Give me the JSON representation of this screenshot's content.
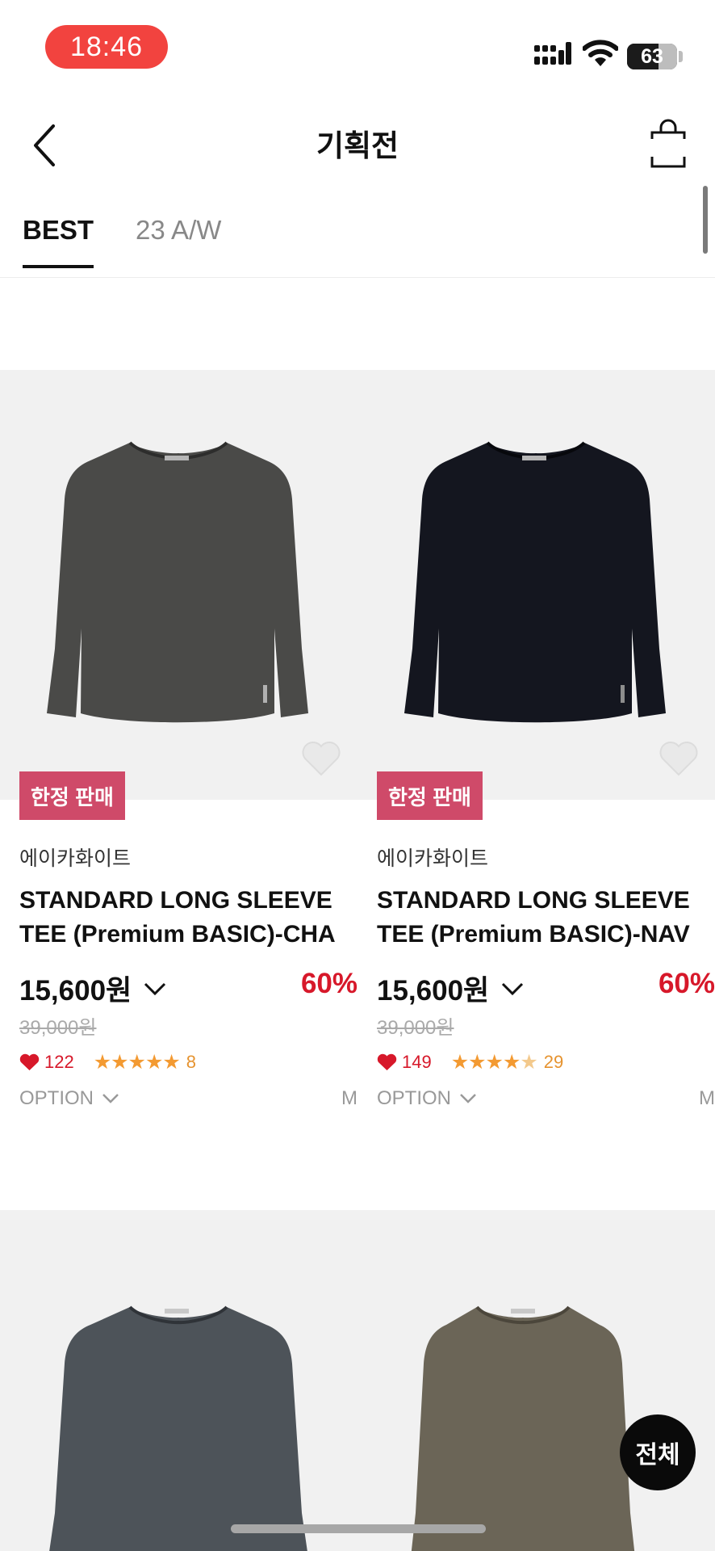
{
  "status_bar": {
    "time": "18:46",
    "battery": "63",
    "battery_level": 0.63
  },
  "header": {
    "title": "기획전",
    "back_icon": "chevron-left-icon",
    "bag_icon": "shopping-bag-icon"
  },
  "tabs": [
    {
      "label": "BEST",
      "active": true
    },
    {
      "label": "23 A/W",
      "active": false
    }
  ],
  "products": [
    {
      "badge": "한정 판매",
      "brand": "에이카화이트",
      "name_line1": "STANDARD LONG SLEEVE",
      "name_line2": "TEE (Premium BASIC)-CHA",
      "price": "15,600원",
      "discount": "60%",
      "original_price": "39,000원",
      "likes": "122",
      "rating": 5,
      "reviews": "8",
      "option_label": "OPTION",
      "size": "M",
      "shirt_color": "#4a4a48"
    },
    {
      "badge": "한정 판매",
      "brand": "에이카화이트",
      "name_line1": "STANDARD LONG SLEEVE",
      "name_line2": "TEE (Premium BASIC)-NAV",
      "price": "15,600원",
      "discount": "60%",
      "original_price": "39,000원",
      "likes": "149",
      "rating": 4.5,
      "reviews": "29",
      "option_label": "OPTION",
      "size": "M",
      "shirt_color": "#14161f"
    },
    {
      "shirt_color": "#4d5359"
    },
    {
      "shirt_color": "#6b6557"
    }
  ],
  "floating_button": {
    "label": "전체"
  },
  "colors": {
    "accent_red": "#d7182a",
    "badge_pink": "#cf4a69",
    "star_orange": "#f39a32",
    "time_pill": "#f2433f"
  }
}
